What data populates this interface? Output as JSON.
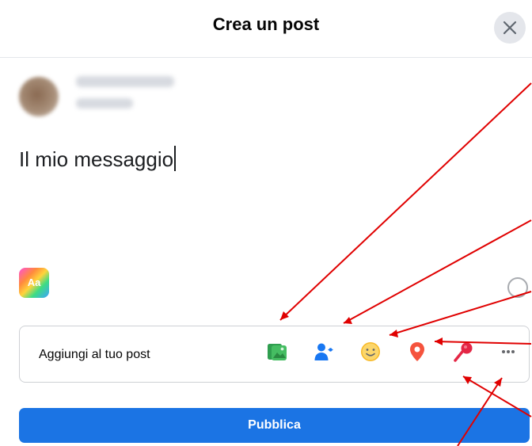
{
  "dialog": {
    "title": "Crea un post",
    "close_icon": "close-icon"
  },
  "composer": {
    "message": "Il mio messaggio",
    "text_format_badge": "Aa"
  },
  "add_to_post": {
    "label": "Aggiungi al tuo post",
    "tools": [
      {
        "name": "photo-video-icon",
        "color": "#45bd62"
      },
      {
        "name": "tag-people-icon",
        "color": "#1877f2"
      },
      {
        "name": "feeling-activity-icon",
        "color": "#f7b928"
      },
      {
        "name": "location-icon",
        "color": "#f5533d"
      },
      {
        "name": "microphone-icon",
        "color": "#e42645"
      },
      {
        "name": "more-icon",
        "color": "#65676b"
      }
    ]
  },
  "actions": {
    "publish_label": "Pubblica"
  },
  "colors": {
    "accent": "#1b74e4",
    "annotation_arrows": "#e00000"
  }
}
